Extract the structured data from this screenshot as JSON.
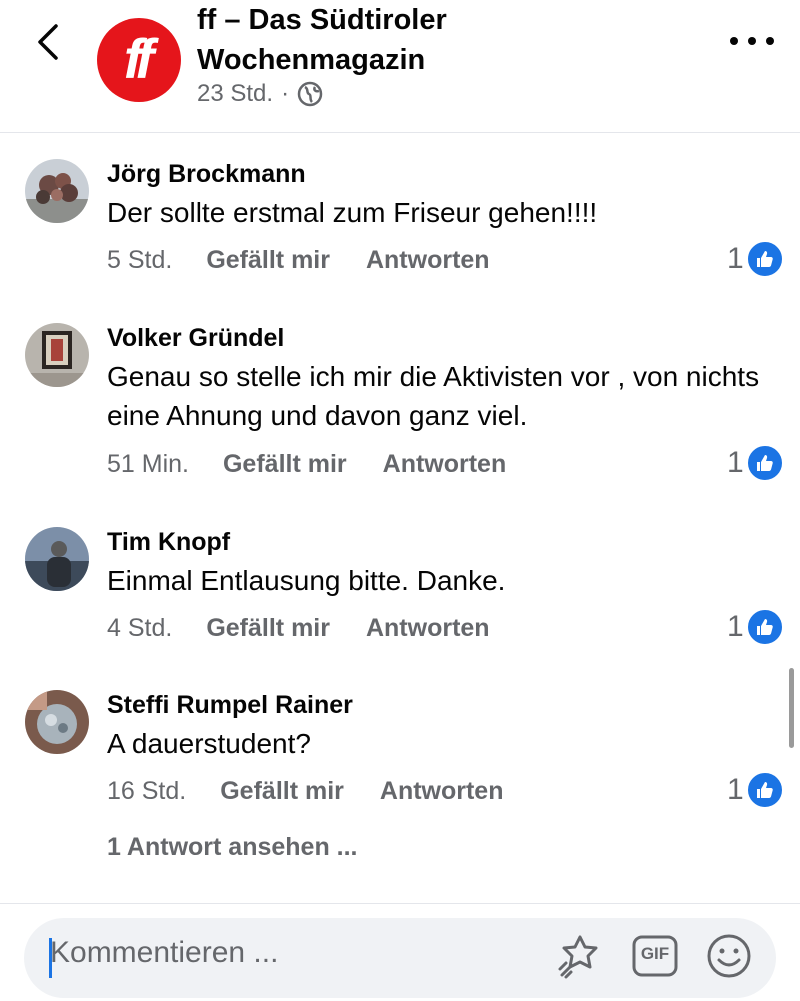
{
  "header": {
    "title": "ff – Das Südtiroler Wochenmagazin",
    "logo_text": "ff",
    "time": "23 Std.",
    "separator": "·",
    "audience_icon": "globe-icon",
    "brand_color": "#e5151b"
  },
  "comments": [
    {
      "name": "Jörg Brockmann",
      "text": "Der sollte erstmal zum Friseur gehen!!!!",
      "time": "5 Std.",
      "like_label": "Gefällt mir",
      "reply_label": "Antworten",
      "reactions": "1"
    },
    {
      "name": "Volker Gründel",
      "text": "Genau so stelle ich mir die Aktivisten vor , von nichts eine Ahnung und davon ganz viel.",
      "time": "51 Min.",
      "like_label": "Gefällt mir",
      "reply_label": "Antworten",
      "reactions": "1"
    },
    {
      "name": "Tim Knopf",
      "text": "Einmal Entlausung bitte. Danke.",
      "time": "4 Std.",
      "like_label": "Gefällt mir",
      "reply_label": "Antworten",
      "reactions": "1"
    },
    {
      "name": "Steffi Rumpel Rainer",
      "text": "A dauerstudent?",
      "time": "16 Std.",
      "like_label": "Gefällt mir",
      "reply_label": "Antworten",
      "reactions": "1",
      "view_replies": "1 Antwort ansehen ..."
    }
  ],
  "composer": {
    "placeholder": "Kommentieren ...",
    "icons": [
      "sticker-icon",
      "gif-icon",
      "emoji-icon"
    ],
    "gif_label": "GIF"
  },
  "colors": {
    "accent": "#1b74e4",
    "secondary_text": "#65676b"
  }
}
